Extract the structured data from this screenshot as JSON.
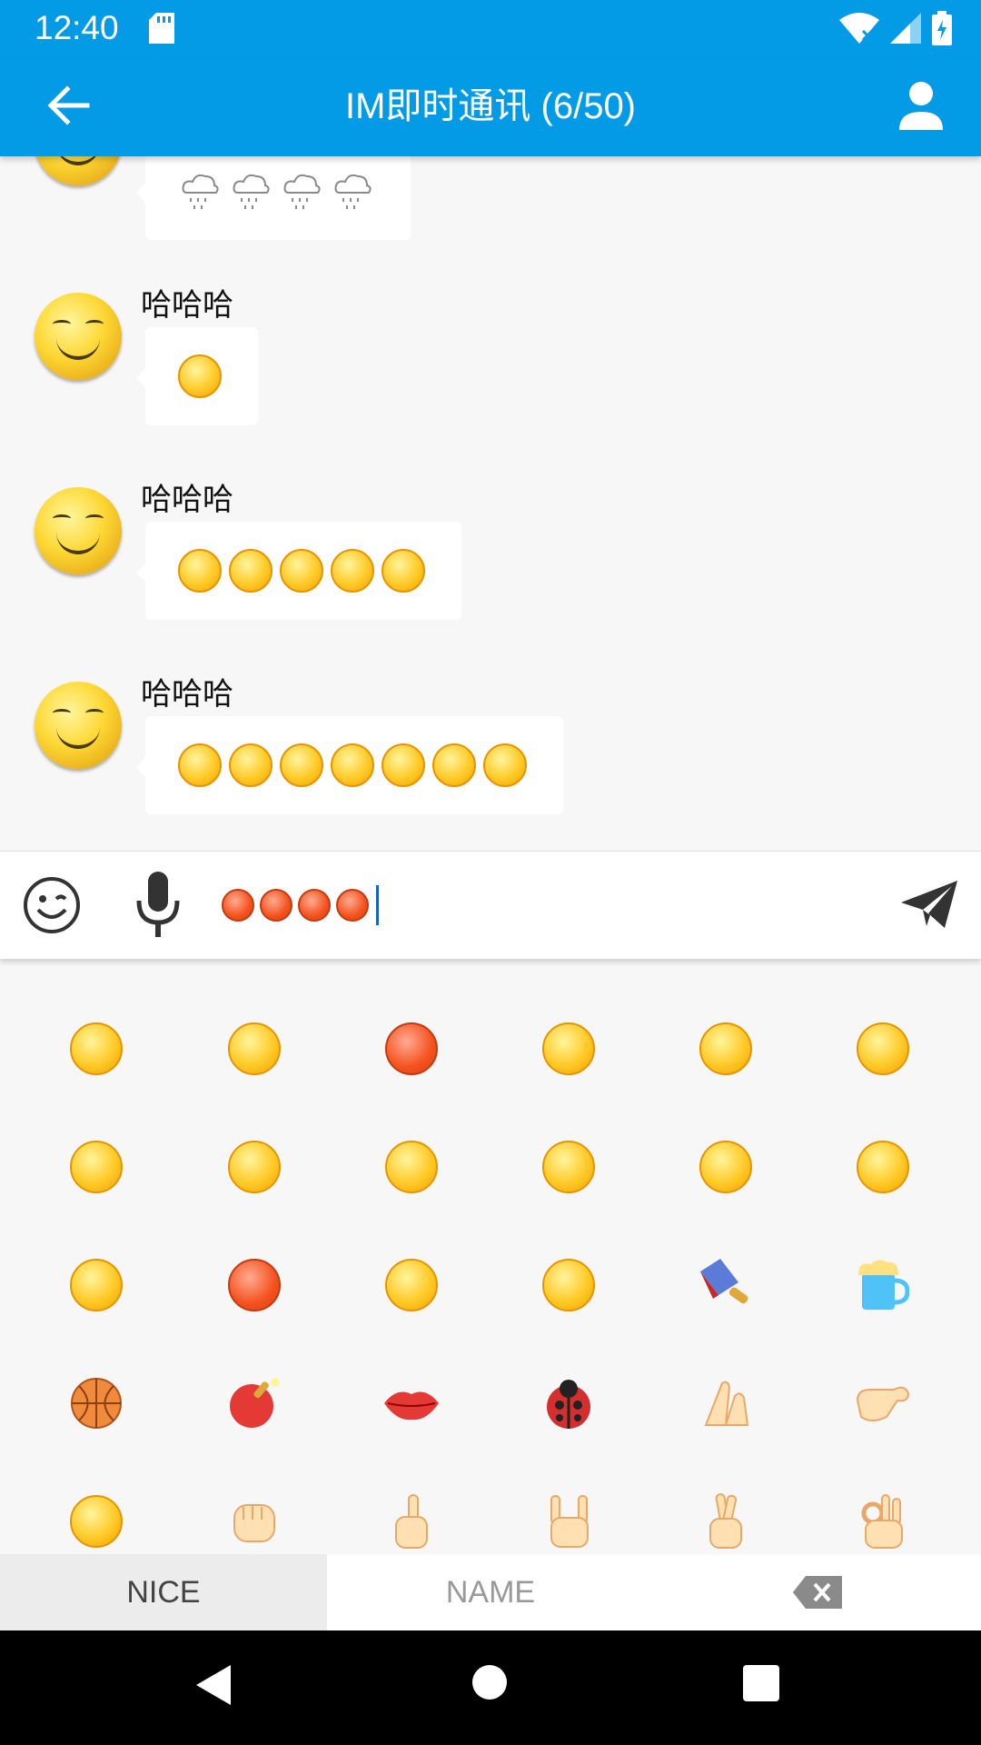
{
  "status": {
    "time": "12:40"
  },
  "appbar": {
    "title": "IM即时通讯 (6/50)"
  },
  "messages": [
    {
      "user": "",
      "emojis": [
        "cloud-rain",
        "cloud-rain",
        "cloud-rain",
        "cloud-rain"
      ]
    },
    {
      "user": "哈哈哈",
      "emojis": [
        "kiss"
      ]
    },
    {
      "user": "哈哈哈",
      "emojis": [
        "kiss",
        "kiss",
        "kiss",
        "kiss",
        "kiss"
      ]
    },
    {
      "user": "哈哈哈",
      "emojis": [
        "grin",
        "grin",
        "grin",
        "pleading",
        "pleading",
        "pleading",
        "pleading"
      ]
    }
  ],
  "input": {
    "emojis": [
      "sweat-red",
      "sweat-red",
      "sweat-red",
      "sweat-red"
    ]
  },
  "emoji_grid": [
    [
      "shocked",
      "confused",
      "sweat-red",
      "sweat-scared",
      "teeth-grin",
      "wink"
    ],
    [
      "smirk",
      "yawn",
      "angry-fist",
      "sad-sigh",
      "sad",
      "grin"
    ],
    [
      "kiss",
      "furious",
      "dizzy-shocked",
      "pleading",
      "cleaver",
      "beer-mug"
    ],
    [
      "basketball",
      "ping-pong",
      "lips",
      "ladybug",
      "pray",
      "pinky-hook"
    ],
    [
      "tongue-out",
      "fist",
      "point-up",
      "rock-on",
      "victory",
      "ok-hand"
    ]
  ],
  "tabs": {
    "nice": "NICE",
    "name": "NAME"
  },
  "colors": {
    "primary": "#039be5",
    "panel_bg": "#f7f7f7",
    "caret": "#1565c0"
  }
}
